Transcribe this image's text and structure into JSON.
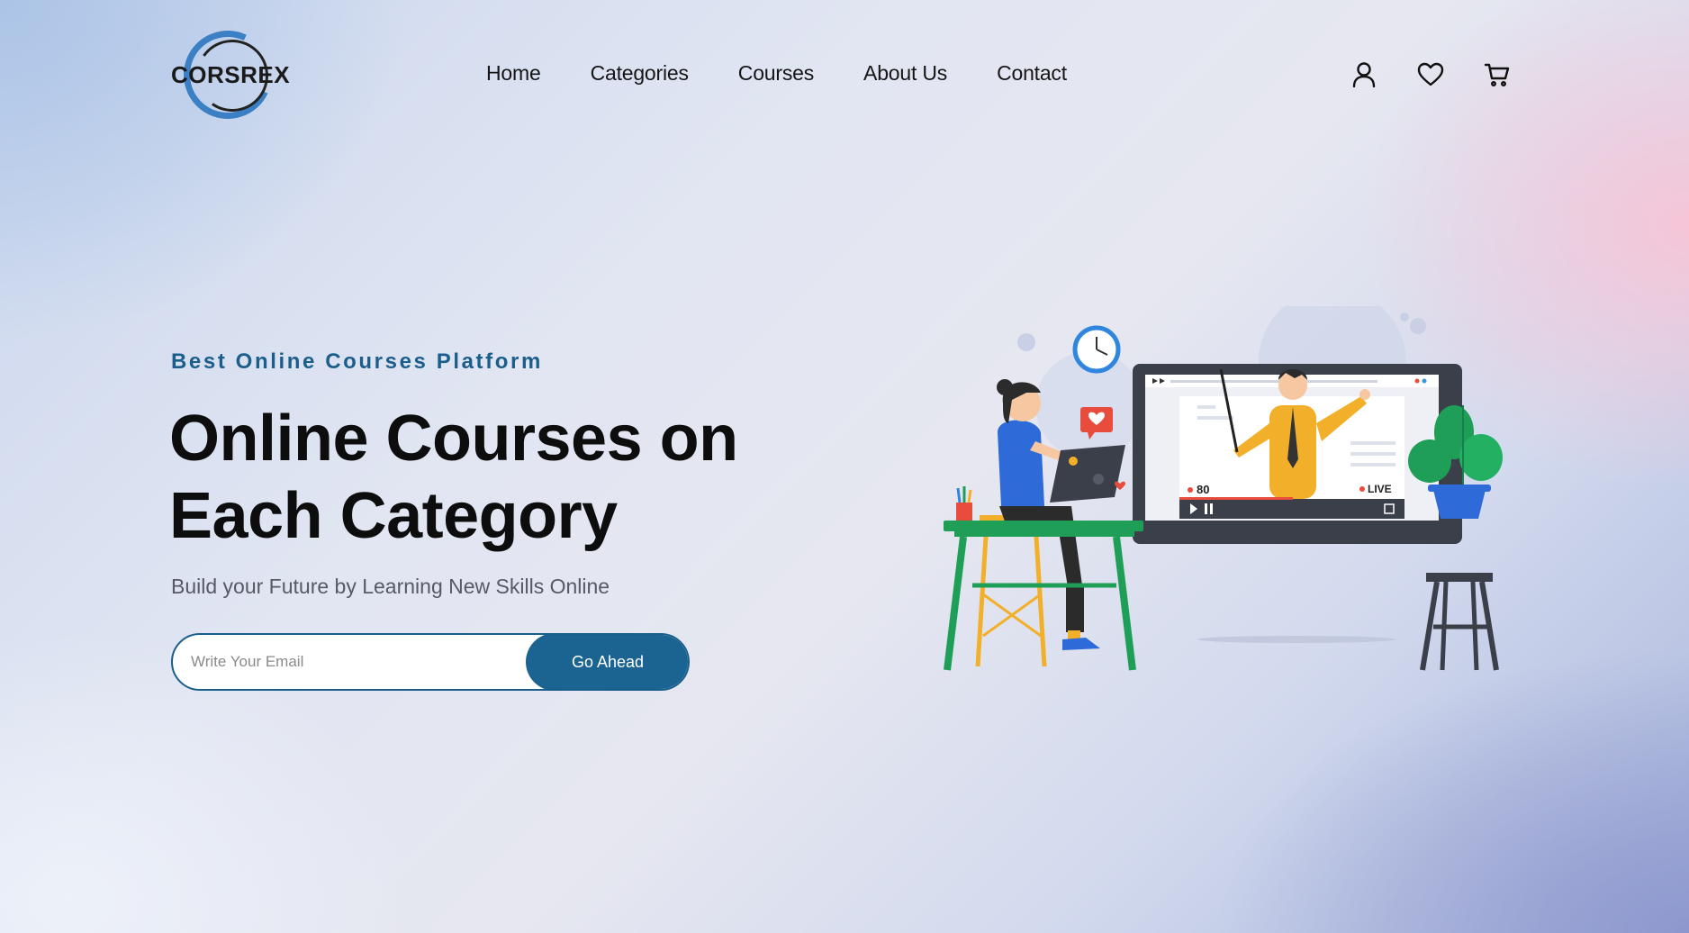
{
  "brand": {
    "logo_text": "CORSREX"
  },
  "nav": {
    "items": [
      {
        "label": "Home"
      },
      {
        "label": "Categories"
      },
      {
        "label": "Courses"
      },
      {
        "label": "About Us"
      },
      {
        "label": "Contact"
      }
    ]
  },
  "header_icons": [
    "user-icon",
    "heart-icon",
    "cart-icon"
  ],
  "hero": {
    "eyebrow": "Best Online Courses Platform",
    "headline_line1": "Online Courses on",
    "headline_line2": "Each Category",
    "subtitle": "Build your Future by Learning New Skills Online",
    "email_placeholder": "Write Your Email",
    "email_value": "",
    "cta_label": "Go Ahead"
  },
  "illustration": {
    "viewer_count": "80",
    "live_label": "LIVE"
  },
  "colors": {
    "accent": "#1b6491",
    "eyebrow": "#1b5e8c",
    "heading": "#0d0d0d"
  }
}
